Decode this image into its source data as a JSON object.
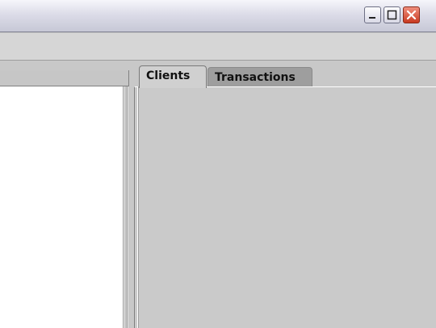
{
  "window": {
    "controls": {
      "minimize": "minimize-icon",
      "maximize": "maximize-icon",
      "close": "close-icon"
    }
  },
  "tabs": [
    {
      "label": "Clients",
      "selected": true
    },
    {
      "label": "Transactions",
      "selected": false
    }
  ],
  "colors": {
    "panel_gray": "#c8c8c8",
    "list_background": "#ffffff",
    "close_red": "#c83a21"
  }
}
